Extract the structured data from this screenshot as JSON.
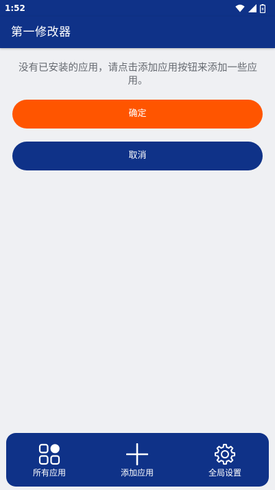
{
  "status_bar": {
    "time": "1:52",
    "icons": [
      "wifi-icon",
      "signal-icon",
      "battery-icon"
    ]
  },
  "app_bar": {
    "title": "第一修改器"
  },
  "main": {
    "message": "没有已安装的应用，请点击添加应用按钮来添加一些应用。",
    "confirm_label": "确定",
    "cancel_label": "取消"
  },
  "bottom_nav": {
    "items": [
      {
        "label": "所有应用",
        "icon": "grid-apps-icon"
      },
      {
        "label": "添加应用",
        "icon": "plus-icon"
      },
      {
        "label": "全局设置",
        "icon": "gear-icon"
      }
    ]
  },
  "colors": {
    "primary": "#0f3288",
    "accent": "#ff5500",
    "background": "#eff0f3",
    "message_text": "#666a71"
  }
}
